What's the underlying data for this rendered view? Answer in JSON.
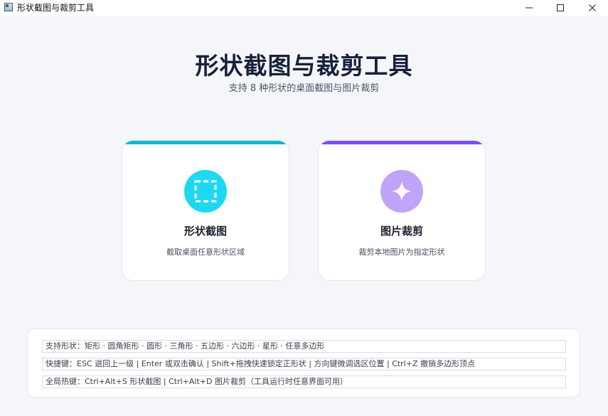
{
  "window": {
    "title": "形状截图与裁剪工具",
    "icon": "app-icon",
    "controls": [
      "minimize-icon",
      "maximize-icon",
      "close-icon"
    ]
  },
  "header": {
    "title": "形状截图与裁剪工具",
    "subtitle": "支持 8 种形状的桌面截图与图片裁剪"
  },
  "cards": [
    {
      "title": "形状截图",
      "description": "截取桌面任意形状区域",
      "icon": "dashed-selection-icon",
      "accent_color": "#13b5cf",
      "icon_bg": "#1ed8f2"
    },
    {
      "title": "图片裁剪",
      "description": "裁剪本地图片为指定形状",
      "icon": "sparkle-star-icon",
      "accent_color": "#7b4ef0",
      "icon_bg": "#c0a4f7"
    }
  ],
  "info": {
    "shapes": "支持形状：矩形 · 圆角矩形 · 圆形 · 三角形 · 五边形 · 六边形 · 星形 · 任意多边形",
    "shortcuts": "快捷键：ESC 退回上一级 | Enter 或双击确认 | Shift+拖拽快速锁定正形状 | 方向键微调选区位置 | Ctrl+Z 撤销多边形顶点",
    "hotkeys": "全局热键：Ctrl+Alt+S 形状截图 | Ctrl+Alt+D 图片裁剪（工具运行时任意界面可用）"
  }
}
